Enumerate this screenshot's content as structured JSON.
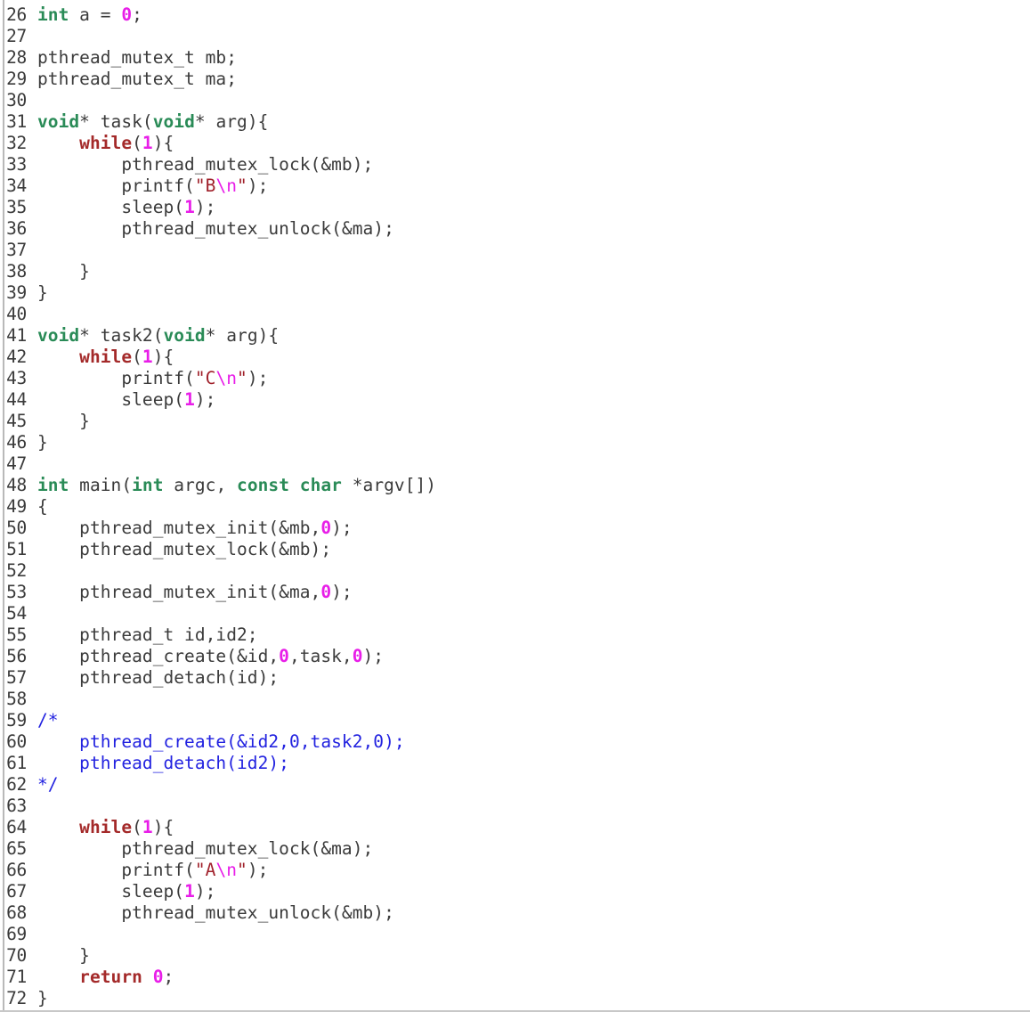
{
  "editor": {
    "name": "code-viewer",
    "language": "C",
    "first_line_number": 26,
    "last_line_number": 72,
    "colors": {
      "background": "#ffffff",
      "foreground": "#3b3b3b",
      "line_number": "#3b3b3b",
      "gutter_rule": "#b9b9b9",
      "type_keyword": "#2a8b57",
      "control_keyword": "#a42a2a",
      "number": "#e81ee8",
      "string": "#a0202a",
      "escape": "#e81ee8",
      "comment": "#2222e0",
      "bottom_border": "#c8c8c8"
    }
  },
  "lines": [
    {
      "number": "26",
      "tokens": [
        {
          "t": "int",
          "c": "type"
        },
        {
          "t": " a = ",
          "c": "plain"
        },
        {
          "t": "0",
          "c": "number"
        },
        {
          "t": ";",
          "c": "plain"
        }
      ]
    },
    {
      "number": "27",
      "tokens": [
        {
          "t": "",
          "c": "plain"
        }
      ]
    },
    {
      "number": "28",
      "tokens": [
        {
          "t": "pthread_mutex_t mb;",
          "c": "plain"
        }
      ]
    },
    {
      "number": "29",
      "tokens": [
        {
          "t": "pthread_mutex_t ma;",
          "c": "plain"
        }
      ]
    },
    {
      "number": "30",
      "tokens": [
        {
          "t": "",
          "c": "plain"
        }
      ]
    },
    {
      "number": "31",
      "tokens": [
        {
          "t": "void",
          "c": "type"
        },
        {
          "t": "* task(",
          "c": "plain"
        },
        {
          "t": "void",
          "c": "type"
        },
        {
          "t": "* arg){",
          "c": "plain"
        }
      ]
    },
    {
      "number": "32",
      "tokens": [
        {
          "t": "    ",
          "c": "plain"
        },
        {
          "t": "while",
          "c": "keyword"
        },
        {
          "t": "(",
          "c": "plain"
        },
        {
          "t": "1",
          "c": "number"
        },
        {
          "t": "){",
          "c": "plain"
        }
      ]
    },
    {
      "number": "33",
      "tokens": [
        {
          "t": "        pthread_mutex_lock(&mb);",
          "c": "plain"
        }
      ]
    },
    {
      "number": "34",
      "tokens": [
        {
          "t": "        printf(",
          "c": "plain"
        },
        {
          "t": "\"B",
          "c": "string"
        },
        {
          "t": "\\n",
          "c": "escape"
        },
        {
          "t": "\"",
          "c": "string"
        },
        {
          "t": ");",
          "c": "plain"
        }
      ]
    },
    {
      "number": "35",
      "tokens": [
        {
          "t": "        sleep(",
          "c": "plain"
        },
        {
          "t": "1",
          "c": "number"
        },
        {
          "t": ");",
          "c": "plain"
        }
      ]
    },
    {
      "number": "36",
      "tokens": [
        {
          "t": "        pthread_mutex_unlock(&ma);",
          "c": "plain"
        }
      ]
    },
    {
      "number": "37",
      "tokens": [
        {
          "t": "",
          "c": "plain"
        }
      ]
    },
    {
      "number": "38",
      "tokens": [
        {
          "t": "    }",
          "c": "plain"
        }
      ]
    },
    {
      "number": "39",
      "tokens": [
        {
          "t": "}",
          "c": "plain"
        }
      ]
    },
    {
      "number": "40",
      "tokens": [
        {
          "t": "",
          "c": "plain"
        }
      ]
    },
    {
      "number": "41",
      "tokens": [
        {
          "t": "void",
          "c": "type"
        },
        {
          "t": "* task2(",
          "c": "plain"
        },
        {
          "t": "void",
          "c": "type"
        },
        {
          "t": "* arg){",
          "c": "plain"
        }
      ]
    },
    {
      "number": "42",
      "tokens": [
        {
          "t": "    ",
          "c": "plain"
        },
        {
          "t": "while",
          "c": "keyword"
        },
        {
          "t": "(",
          "c": "plain"
        },
        {
          "t": "1",
          "c": "number"
        },
        {
          "t": "){",
          "c": "plain"
        }
      ]
    },
    {
      "number": "43",
      "tokens": [
        {
          "t": "        printf(",
          "c": "plain"
        },
        {
          "t": "\"C",
          "c": "string"
        },
        {
          "t": "\\n",
          "c": "escape"
        },
        {
          "t": "\"",
          "c": "string"
        },
        {
          "t": ");",
          "c": "plain"
        }
      ]
    },
    {
      "number": "44",
      "tokens": [
        {
          "t": "        sleep(",
          "c": "plain"
        },
        {
          "t": "1",
          "c": "number"
        },
        {
          "t": ");",
          "c": "plain"
        }
      ]
    },
    {
      "number": "45",
      "tokens": [
        {
          "t": "    }",
          "c": "plain"
        }
      ]
    },
    {
      "number": "46",
      "tokens": [
        {
          "t": "}",
          "c": "plain"
        }
      ]
    },
    {
      "number": "47",
      "tokens": [
        {
          "t": "",
          "c": "plain"
        }
      ]
    },
    {
      "number": "48",
      "tokens": [
        {
          "t": "int",
          "c": "type"
        },
        {
          "t": " main(",
          "c": "plain"
        },
        {
          "t": "int",
          "c": "type"
        },
        {
          "t": " argc, ",
          "c": "plain"
        },
        {
          "t": "const",
          "c": "type"
        },
        {
          "t": " ",
          "c": "plain"
        },
        {
          "t": "char",
          "c": "type"
        },
        {
          "t": " *argv[])",
          "c": "plain"
        }
      ]
    },
    {
      "number": "49",
      "tokens": [
        {
          "t": "{",
          "c": "plain"
        }
      ]
    },
    {
      "number": "50",
      "tokens": [
        {
          "t": "    pthread_mutex_init(&mb,",
          "c": "plain"
        },
        {
          "t": "0",
          "c": "number"
        },
        {
          "t": ");",
          "c": "plain"
        }
      ]
    },
    {
      "number": "51",
      "tokens": [
        {
          "t": "    pthread_mutex_lock(&mb);",
          "c": "plain"
        }
      ]
    },
    {
      "number": "52",
      "tokens": [
        {
          "t": "",
          "c": "plain"
        }
      ]
    },
    {
      "number": "53",
      "tokens": [
        {
          "t": "    pthread_mutex_init(&ma,",
          "c": "plain"
        },
        {
          "t": "0",
          "c": "number"
        },
        {
          "t": ");",
          "c": "plain"
        }
      ]
    },
    {
      "number": "54",
      "tokens": [
        {
          "t": "",
          "c": "plain"
        }
      ]
    },
    {
      "number": "55",
      "tokens": [
        {
          "t": "    pthread_t id,id2;",
          "c": "plain"
        }
      ]
    },
    {
      "number": "56",
      "tokens": [
        {
          "t": "    pthread_create(&id,",
          "c": "plain"
        },
        {
          "t": "0",
          "c": "number"
        },
        {
          "t": ",task,",
          "c": "plain"
        },
        {
          "t": "0",
          "c": "number"
        },
        {
          "t": ");",
          "c": "plain"
        }
      ]
    },
    {
      "number": "57",
      "tokens": [
        {
          "t": "    pthread_detach(id);",
          "c": "plain"
        }
      ]
    },
    {
      "number": "58",
      "tokens": [
        {
          "t": "",
          "c": "plain"
        }
      ]
    },
    {
      "number": "59",
      "tokens": [
        {
          "t": "/*",
          "c": "comment"
        }
      ]
    },
    {
      "number": "60",
      "tokens": [
        {
          "t": "    pthread_create(&id2,0,task2,0);",
          "c": "comment"
        }
      ]
    },
    {
      "number": "61",
      "tokens": [
        {
          "t": "    pthread_detach(id2);",
          "c": "comment"
        }
      ]
    },
    {
      "number": "62",
      "tokens": [
        {
          "t": "*/",
          "c": "comment"
        }
      ]
    },
    {
      "number": "63",
      "tokens": [
        {
          "t": "",
          "c": "plain"
        }
      ]
    },
    {
      "number": "64",
      "tokens": [
        {
          "t": "    ",
          "c": "plain"
        },
        {
          "t": "while",
          "c": "keyword"
        },
        {
          "t": "(",
          "c": "plain"
        },
        {
          "t": "1",
          "c": "number"
        },
        {
          "t": "){",
          "c": "plain"
        }
      ]
    },
    {
      "number": "65",
      "tokens": [
        {
          "t": "        pthread_mutex_lock(&ma);",
          "c": "plain"
        }
      ]
    },
    {
      "number": "66",
      "tokens": [
        {
          "t": "        printf(",
          "c": "plain"
        },
        {
          "t": "\"A",
          "c": "string"
        },
        {
          "t": "\\n",
          "c": "escape"
        },
        {
          "t": "\"",
          "c": "string"
        },
        {
          "t": ");",
          "c": "plain"
        }
      ]
    },
    {
      "number": "67",
      "tokens": [
        {
          "t": "        sleep(",
          "c": "plain"
        },
        {
          "t": "1",
          "c": "number"
        },
        {
          "t": ");",
          "c": "plain"
        }
      ]
    },
    {
      "number": "68",
      "tokens": [
        {
          "t": "        pthread_mutex_unlock(&mb);",
          "c": "plain"
        }
      ]
    },
    {
      "number": "69",
      "tokens": [
        {
          "t": "",
          "c": "plain"
        }
      ]
    },
    {
      "number": "70",
      "tokens": [
        {
          "t": "    }",
          "c": "plain"
        }
      ]
    },
    {
      "number": "71",
      "tokens": [
        {
          "t": "    ",
          "c": "plain"
        },
        {
          "t": "return",
          "c": "keyword"
        },
        {
          "t": " ",
          "c": "plain"
        },
        {
          "t": "0",
          "c": "number"
        },
        {
          "t": ";",
          "c": "plain"
        }
      ]
    },
    {
      "number": "72",
      "tokens": [
        {
          "t": "}",
          "c": "plain"
        }
      ]
    }
  ]
}
